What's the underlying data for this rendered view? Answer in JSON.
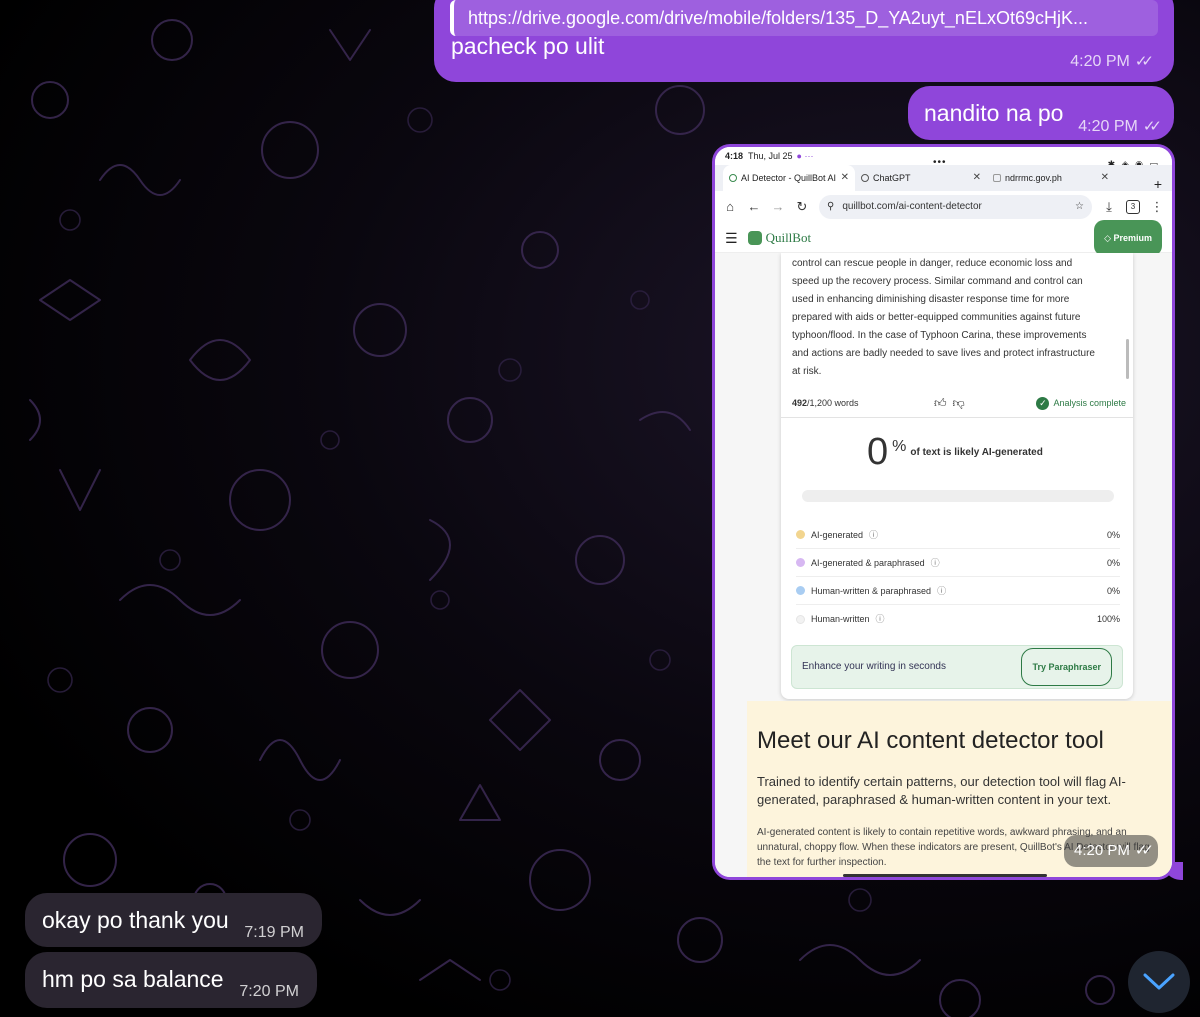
{
  "messages": {
    "link": {
      "url": "https://drive.google.com/drive/mobile/folders/135_D_YA2uyt_nELxOt69cHjK...",
      "text": "pacheck po ulit",
      "time": "4:20 PM"
    },
    "m2": {
      "text": "nandito na po",
      "time": "4:20 PM"
    },
    "image": {
      "time": "4:20 PM"
    },
    "m3": {
      "text": "okay po thank you",
      "time": "7:19 PM"
    },
    "m4": {
      "text": "hm po sa balance",
      "time": "7:20 PM"
    }
  },
  "screenshot": {
    "status": {
      "time": "4:18",
      "date": "Thu, Jul 25"
    },
    "tabs": [
      {
        "label": "AI Detector - QuillBot AI"
      },
      {
        "label": "ChatGPT"
      },
      {
        "label": "ndrrmc.gov.ph"
      }
    ],
    "url": "quillbot.com/ai-content-detector",
    "tab_count": "3",
    "brand": "QuillBot",
    "premium_label": "Premium",
    "essay_text": "control can rescue people in danger, reduce economic loss and speed up the recovery process. Similar command and control can used in enhancing diminishing disaster response time for more prepared with aids or better-equipped communities against future typhoon/flood. In the case of Typhoon Carina, these improvements and actions are badly needed to save lives and protect infrastructure at risk.",
    "word_count_bold": "492",
    "word_count_rest": "/1,200 words",
    "analysis_label": "Analysis complete",
    "score_value": "0",
    "score_percent": "%",
    "score_label": "of text is likely AI-generated",
    "categories": [
      {
        "label": "AI-generated",
        "value": "0%",
        "color": "#f2d58f"
      },
      {
        "label": "AI-generated & paraphrased",
        "value": "0%",
        "color": "#d7b8f2"
      },
      {
        "label": "Human-written & paraphrased",
        "value": "0%",
        "color": "#a9cdf2"
      },
      {
        "label": "Human-written",
        "value": "100%",
        "color": "#f2f2f2"
      }
    ],
    "enhance_text": "Enhance your writing in seconds",
    "try_label": "Try Paraphraser",
    "meet_title": "Meet our AI content detector tool",
    "meet_p1": "Trained to identify certain patterns, our detection tool will flag AI-generated, paraphrased & human-written content in your text.",
    "meet_p2": "AI-generated content is likely to contain repetitive words, awkward phrasing, and an unnatural, choppy flow. When these indicators are present, QuillBot's AI Detector will flag the text for further inspection."
  },
  "colors": {
    "outgoing_bubble": "#8f46da",
    "incoming_bubble": "#2a2530",
    "quillbot_green": "#499557"
  }
}
